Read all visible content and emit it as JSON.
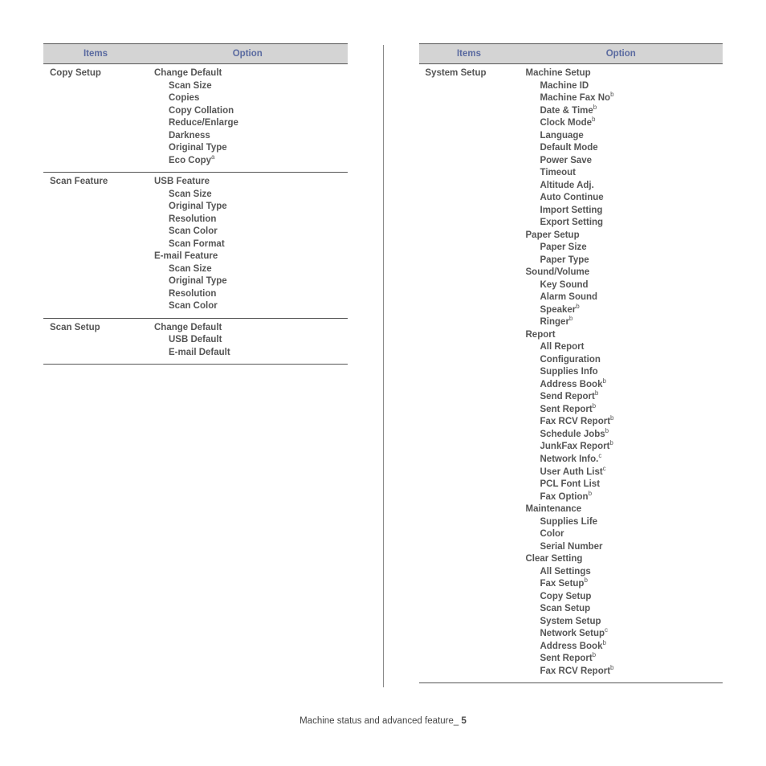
{
  "headers": {
    "items": "Items",
    "option": "Option"
  },
  "left": [
    {
      "item": "Copy Setup",
      "options": [
        {
          "t": "Change Default",
          "lvl": 0
        },
        {
          "t": "Scan Size",
          "lvl": 1
        },
        {
          "t": "Copies",
          "lvl": 1
        },
        {
          "t": "Copy Collation",
          "lvl": 1
        },
        {
          "t": "Reduce/Enlarge",
          "lvl": 1
        },
        {
          "t": "Darkness",
          "lvl": 1
        },
        {
          "t": "Original Type",
          "lvl": 1
        },
        {
          "t": "Eco Copy",
          "lvl": 1,
          "sup": "a"
        }
      ]
    },
    {
      "item": "Scan Feature",
      "options": [
        {
          "t": "USB Feature",
          "lvl": 0
        },
        {
          "t": "Scan Size",
          "lvl": 1
        },
        {
          "t": "Original Type",
          "lvl": 1
        },
        {
          "t": "Resolution",
          "lvl": 1
        },
        {
          "t": "Scan Color",
          "lvl": 1
        },
        {
          "t": "Scan Format",
          "lvl": 1
        },
        {
          "t": "E-mail Feature",
          "lvl": 0
        },
        {
          "t": "Scan Size",
          "lvl": 1
        },
        {
          "t": "Original Type",
          "lvl": 1
        },
        {
          "t": "Resolution",
          "lvl": 1
        },
        {
          "t": "Scan Color",
          "lvl": 1
        }
      ]
    },
    {
      "item": "Scan Setup",
      "options": [
        {
          "t": "Change Default",
          "lvl": 0
        },
        {
          "t": "USB Default",
          "lvl": 1
        },
        {
          "t": "E-mail Default",
          "lvl": 1
        }
      ]
    }
  ],
  "right": [
    {
      "item": "System Setup",
      "options": [
        {
          "t": "Machine Setup",
          "lvl": 0
        },
        {
          "t": "Machine ID",
          "lvl": 1
        },
        {
          "t": "Machine Fax No",
          "lvl": 1,
          "sup": "b"
        },
        {
          "t": "Date & Time",
          "lvl": 1,
          "sup": "b"
        },
        {
          "t": "Clock Mode",
          "lvl": 1,
          "sup": "b"
        },
        {
          "t": "Language",
          "lvl": 1
        },
        {
          "t": "Default Mode",
          "lvl": 1
        },
        {
          "t": "Power Save",
          "lvl": 1
        },
        {
          "t": "Timeout",
          "lvl": 1
        },
        {
          "t": "Altitude Adj.",
          "lvl": 1
        },
        {
          "t": "Auto Continue",
          "lvl": 1
        },
        {
          "t": "Import Setting",
          "lvl": 1
        },
        {
          "t": "Export Setting",
          "lvl": 1
        },
        {
          "t": "Paper Setup",
          "lvl": 0
        },
        {
          "t": "Paper Size",
          "lvl": 1
        },
        {
          "t": "Paper Type",
          "lvl": 1
        },
        {
          "t": "Sound/Volume",
          "lvl": 0
        },
        {
          "t": "Key Sound",
          "lvl": 1
        },
        {
          "t": "Alarm Sound",
          "lvl": 1
        },
        {
          "t": "Speaker",
          "lvl": 1,
          "sup": "b"
        },
        {
          "t": "Ringer",
          "lvl": 1,
          "sup": "b"
        },
        {
          "t": "Report",
          "lvl": 0
        },
        {
          "t": "All Report",
          "lvl": 1
        },
        {
          "t": "Configuration",
          "lvl": 1
        },
        {
          "t": "Supplies Info",
          "lvl": 1
        },
        {
          "t": "Address Book",
          "lvl": 1,
          "sup": "b"
        },
        {
          "t": "Send Report",
          "lvl": 1,
          "sup": "b"
        },
        {
          "t": "Sent Report",
          "lvl": 1,
          "sup": "b"
        },
        {
          "t": "Fax RCV Report",
          "lvl": 1,
          "sup": "b"
        },
        {
          "t": "Schedule Jobs",
          "lvl": 1,
          "sup": "b"
        },
        {
          "t": "JunkFax Report",
          "lvl": 1,
          "sup": "b"
        },
        {
          "t": "Network Info.",
          "lvl": 1,
          "sup": "c"
        },
        {
          "t": "User Auth List",
          "lvl": 1,
          "sup": "c"
        },
        {
          "t": "PCL Font List",
          "lvl": 1
        },
        {
          "t": "Fax Option",
          "lvl": 1,
          "sup": "b"
        },
        {
          "t": "Maintenance",
          "lvl": 0
        },
        {
          "t": "Supplies Life",
          "lvl": 1
        },
        {
          "t": "Color",
          "lvl": 1
        },
        {
          "t": "Serial Number",
          "lvl": 1
        },
        {
          "t": "Clear Setting",
          "lvl": 0
        },
        {
          "t": "All Settings",
          "lvl": 1
        },
        {
          "t": "Fax Setup",
          "lvl": 1,
          "sup": "b"
        },
        {
          "t": "Copy Setup",
          "lvl": 1
        },
        {
          "t": "Scan Setup",
          "lvl": 1
        },
        {
          "t": "System Setup",
          "lvl": 1
        },
        {
          "t": "Network Setup",
          "lvl": 1,
          "sup": "c"
        },
        {
          "t": "Address Book",
          "lvl": 1,
          "sup": "b"
        },
        {
          "t": "Sent Report",
          "lvl": 1,
          "sup": "b"
        },
        {
          "t": "Fax RCV Report",
          "lvl": 1,
          "sup": "b"
        }
      ]
    }
  ],
  "footer": {
    "text": "Machine status and advanced feature",
    "sep": "_",
    "page": "5"
  }
}
